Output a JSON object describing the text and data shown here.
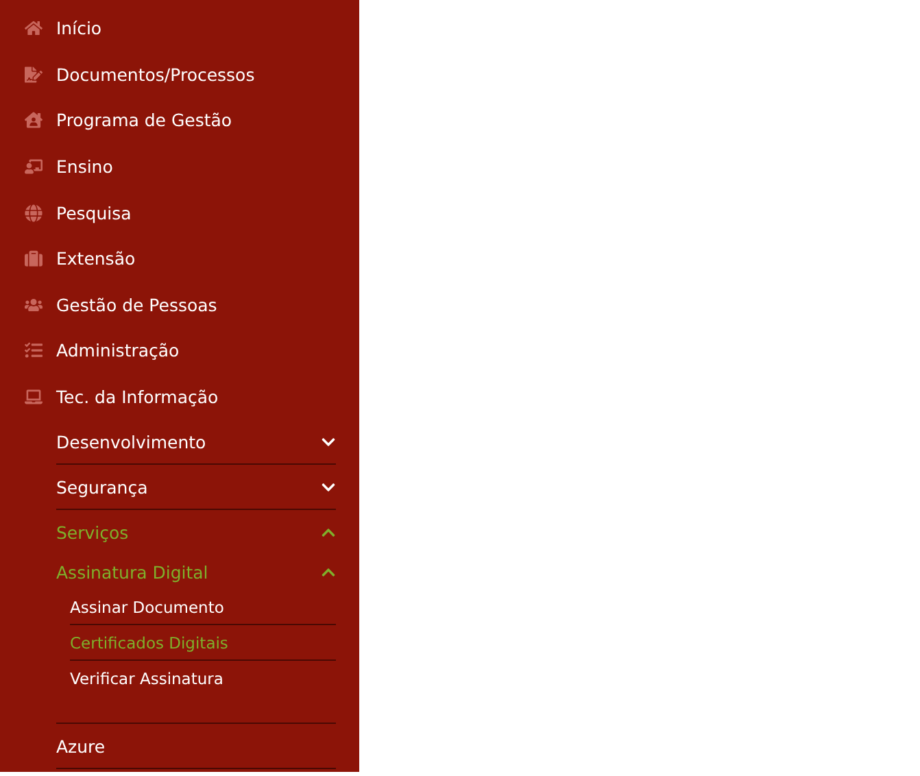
{
  "sidebar": {
    "items": [
      {
        "label": "Início"
      },
      {
        "label": "Documentos/Processos"
      },
      {
        "label": "Programa de Gestão"
      },
      {
        "label": "Ensino"
      },
      {
        "label": "Pesquisa"
      },
      {
        "label": "Extensão"
      },
      {
        "label": "Gestão de Pessoas"
      },
      {
        "label": "Administração"
      },
      {
        "label": "Tec. da Informação",
        "children": [
          {
            "label": "Desenvolvimento",
            "expanded": false,
            "selected": false
          },
          {
            "label": "Segurança",
            "expanded": false,
            "selected": false
          },
          {
            "label": "Serviços",
            "expanded": true,
            "selected": true,
            "children": [
              {
                "label": "Assinatura Digital",
                "expanded": true,
                "selected": true,
                "children": [
                  {
                    "label": "Assinar Documento",
                    "selected": false
                  },
                  {
                    "label": "Certificados Digitais",
                    "selected": true
                  },
                  {
                    "label": "Verificar Assinatura",
                    "selected": false
                  }
                ]
              }
            ]
          },
          {
            "label": "Azure",
            "selected": false
          }
        ]
      }
    ]
  }
}
